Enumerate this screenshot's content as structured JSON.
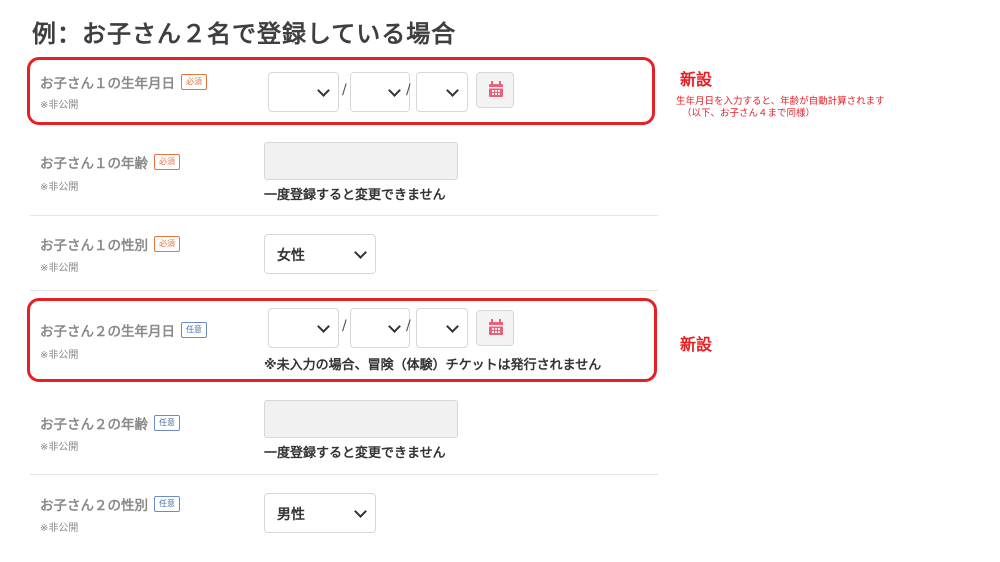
{
  "heading": "例：お子さん２名で登録している場合",
  "rows": [
    {
      "label": "お子さん１の生年月日",
      "badge": "必須",
      "sub": "※非公開"
    },
    {
      "label": "お子さん１の年齢",
      "badge": "必須",
      "sub": "※非公開",
      "helper": "一度登録すると変更できません"
    },
    {
      "label": "お子さん１の性別",
      "badge": "必須",
      "sub": "※非公開",
      "value": "女性"
    },
    {
      "label": "お子さん２の生年月日",
      "badge": "任意",
      "sub": "※非公開",
      "helper": "※未入力の場合、冒険（体験）チケットは発行されません"
    },
    {
      "label": "お子さん２の年齢",
      "badge": "任意",
      "sub": "※非公開",
      "helper": "一度登録すると変更できません"
    },
    {
      "label": "お子さん２の性別",
      "badge": "任意",
      "sub": "※非公開",
      "value": "男性"
    }
  ],
  "date_separator": "/",
  "annotations": {
    "new_label": "新設",
    "note_line1": "生年月日を入力すると、年齢が自動計算されます",
    "note_line2": "（以下、お子さん４まで同様）"
  },
  "colors": {
    "highlight": "#e52126",
    "required_badge": "#e8743b",
    "optional_badge": "#4a6fa5",
    "calendar_icon": "#e8627a"
  }
}
